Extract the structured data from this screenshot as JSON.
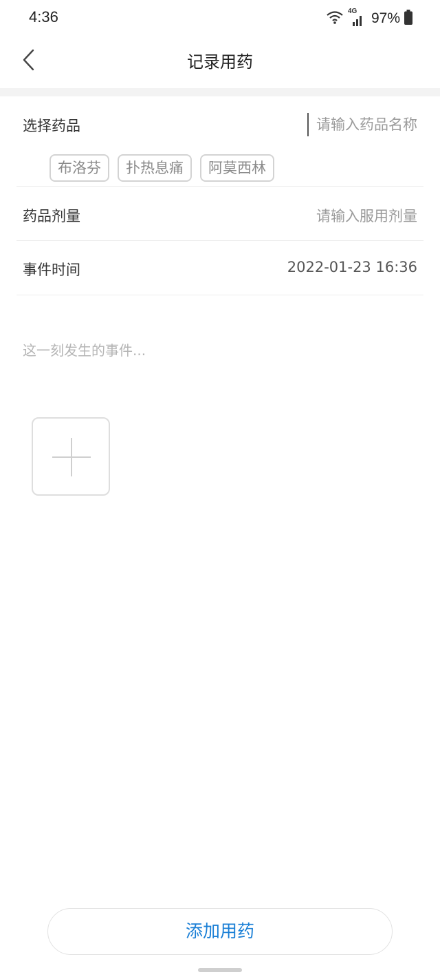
{
  "status_bar": {
    "time": "4:36",
    "network": "4G",
    "battery": "97%"
  },
  "header": {
    "back_icon": "chevron-left-icon",
    "title": "记录用药"
  },
  "form": {
    "drug": {
      "label": "选择药品",
      "placeholder": "请输入药品名称",
      "value": "",
      "suggestions": [
        "布洛芬",
        "扑热息痛",
        "阿莫西林"
      ]
    },
    "dosage": {
      "label": "药品剂量",
      "placeholder": "请输入服用剂量"
    },
    "time": {
      "label": "事件时间",
      "value": "2022-01-23 16:36"
    },
    "event": {
      "placeholder": "这一刻发生的事件..."
    },
    "add_photo_icon": "plus-icon"
  },
  "actions": {
    "submit_label": "添加用药"
  },
  "colors": {
    "accent": "#1a7fd6",
    "placeholder": "#9a9a9a",
    "divider": "#ececec",
    "section_gap": "#f3f3f3"
  }
}
